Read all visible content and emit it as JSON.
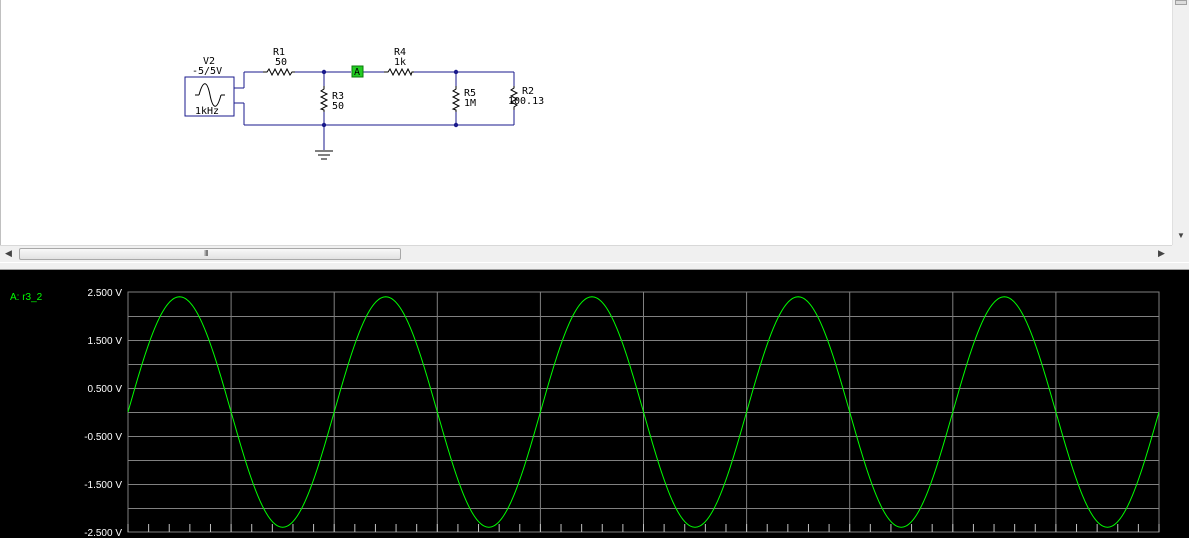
{
  "schematic": {
    "source": {
      "name": "V2",
      "amplitude": "-5/5V",
      "frequency": "1kHz"
    },
    "resistors": [
      {
        "name": "R1",
        "value": "50"
      },
      {
        "name": "R4",
        "value": "1k"
      },
      {
        "name": "R3",
        "value": "50"
      },
      {
        "name": "R5",
        "value": "1M"
      },
      {
        "name": "R2",
        "value": "100.13"
      }
    ],
    "probe": {
      "label": "A"
    }
  },
  "scrollbar": {
    "grip": "III"
  },
  "scope": {
    "probe_label": "A: r3_2",
    "trace_color": "#00ff00"
  },
  "chart_data": {
    "type": "line",
    "title": "",
    "xlabel": "",
    "ylabel": "",
    "y_tick_labels": [
      "2.500 V",
      "1.500 V",
      "0.500 V",
      "-0.500 V",
      "-1.500 V",
      "-2.500 V"
    ],
    "y_ticks": [
      2.5,
      1.5,
      0.5,
      -0.5,
      -1.5,
      -2.5
    ],
    "ylim": [
      -2.5,
      2.5
    ],
    "xlim": [
      0,
      5
    ],
    "grid": true,
    "series": [
      {
        "name": "A: r3_2",
        "waveform": "sine",
        "amplitude": 2.4,
        "offset": 0,
        "cycles": 5,
        "phase": 0
      }
    ]
  }
}
